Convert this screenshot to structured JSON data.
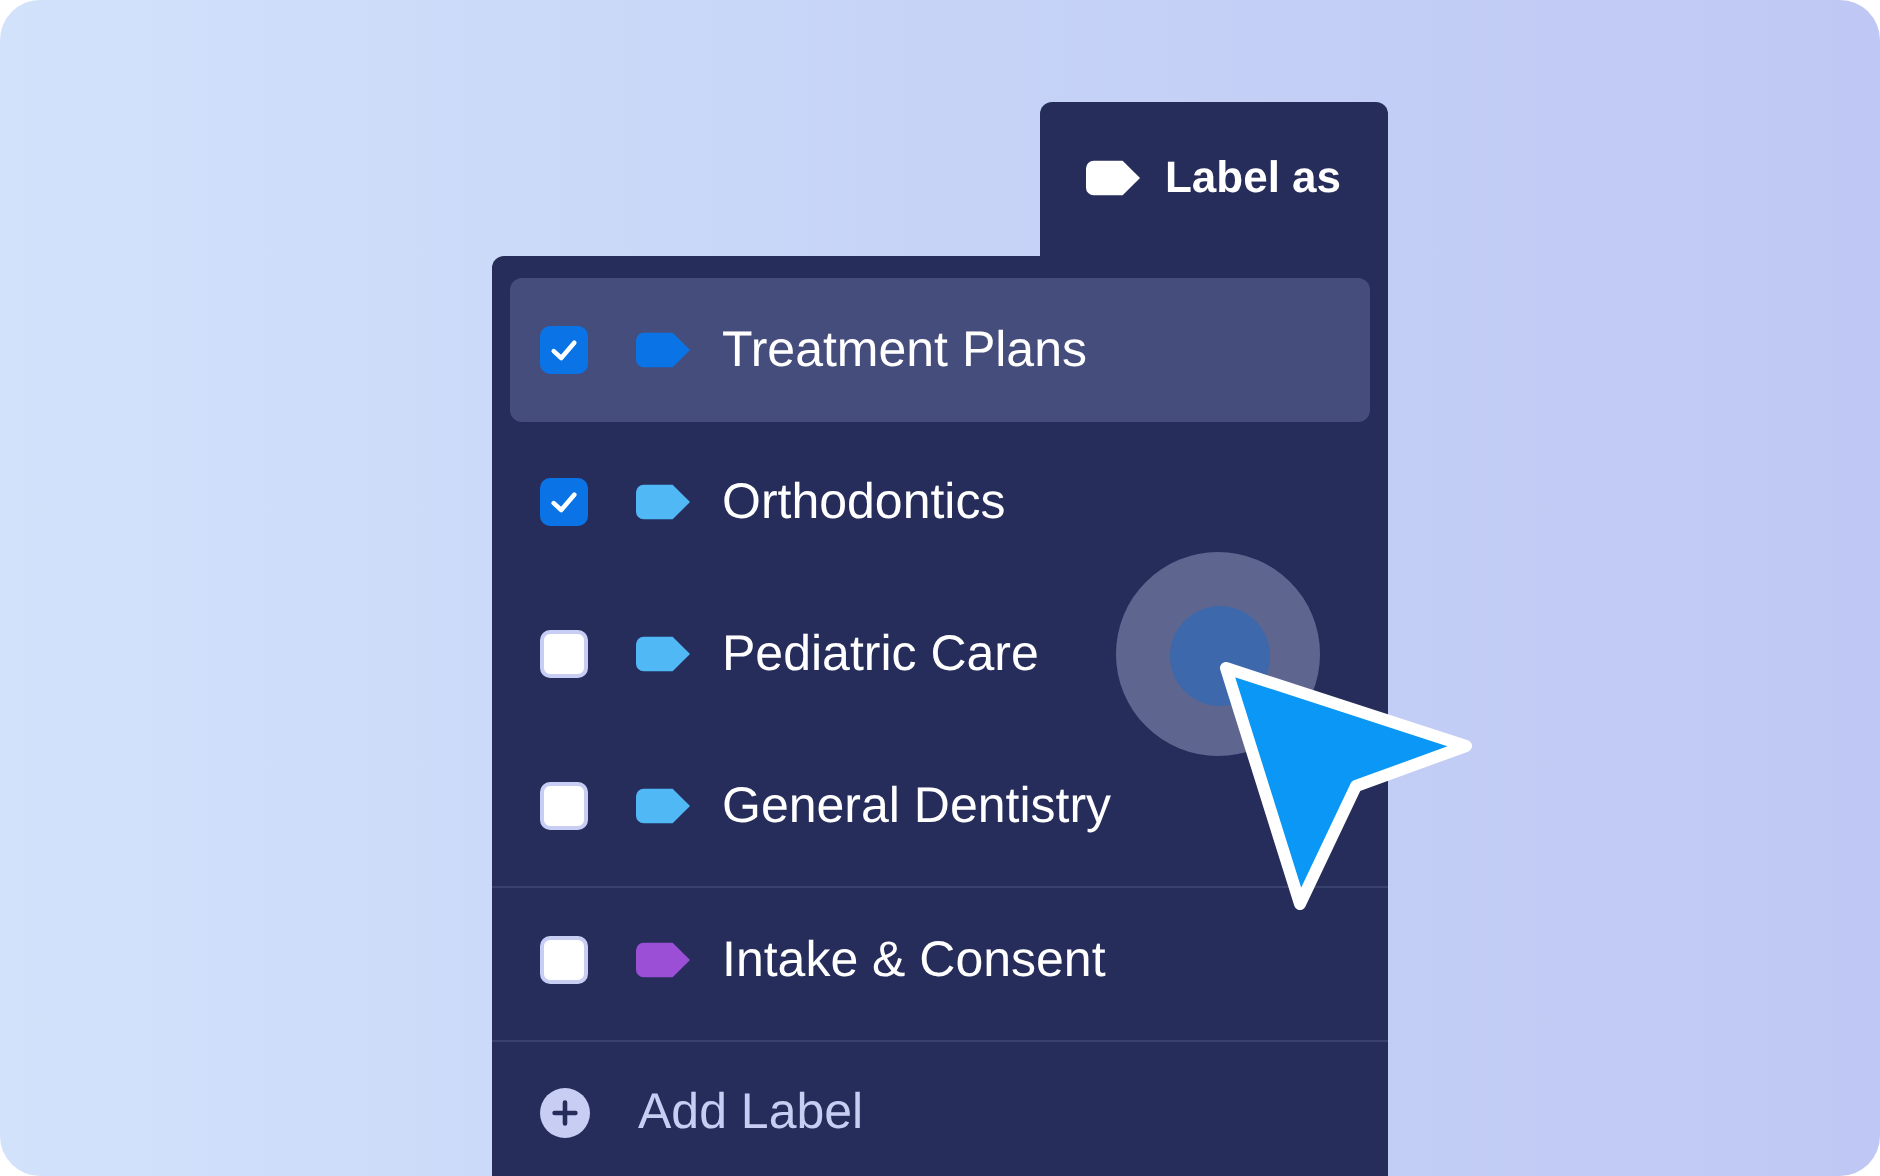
{
  "menu": {
    "title": "Label as",
    "label_groups": [
      {
        "labels": [
          {
            "name": "Treatment Plans",
            "checked": true,
            "selected": true,
            "color": "#0a73e6"
          },
          {
            "name": "Orthodontics",
            "checked": true,
            "selected": false,
            "color": "#4fb8f5"
          },
          {
            "name": "Pediatric Care",
            "checked": false,
            "selected": false,
            "color": "#4fb8f5"
          },
          {
            "name": "General Dentistry",
            "checked": false,
            "selected": false,
            "color": "#4fb8f5"
          }
        ]
      },
      {
        "labels": [
          {
            "name": "Intake & Consent",
            "checked": false,
            "selected": false,
            "color": "#9b4fd6"
          }
        ]
      }
    ],
    "add_button": "Add Label"
  }
}
